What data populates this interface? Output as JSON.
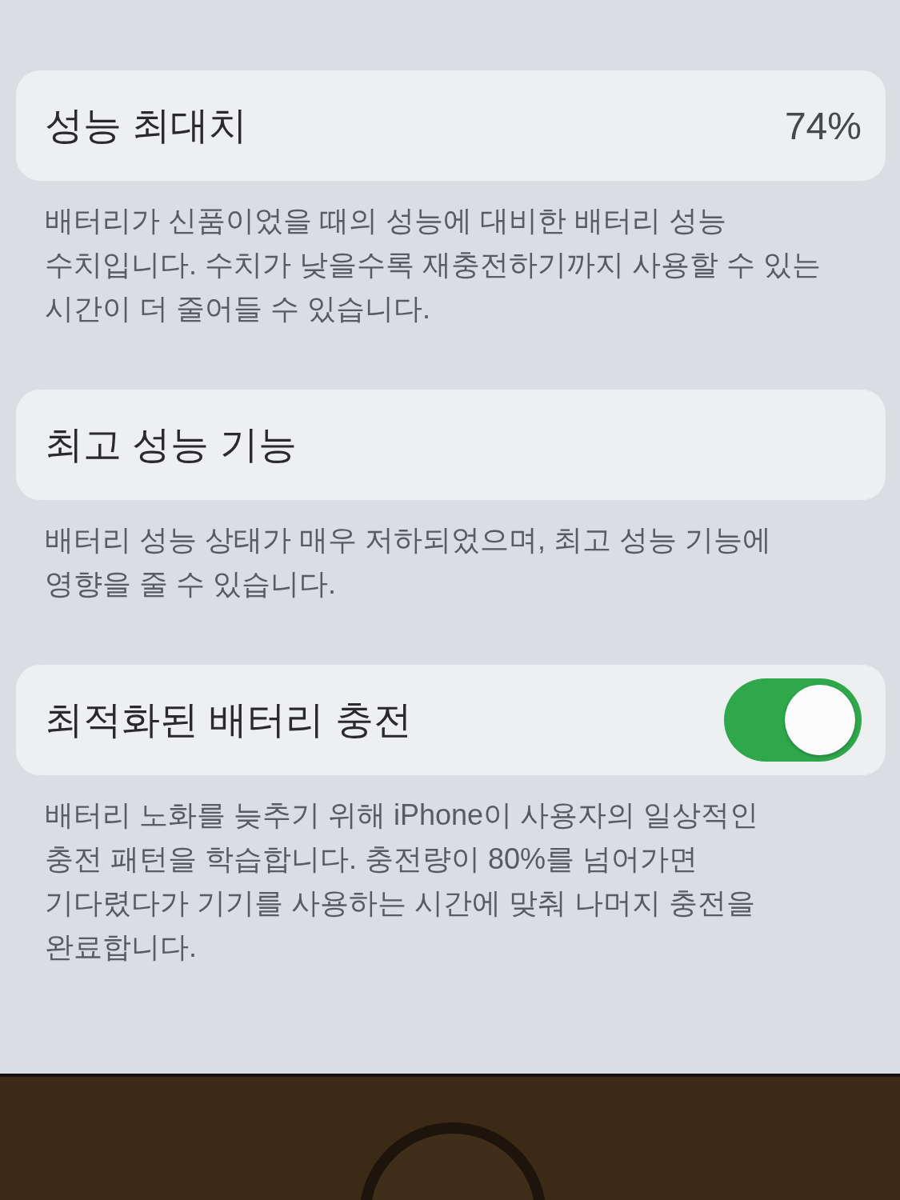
{
  "sections": [
    {
      "kind": "value",
      "title": "성능 최대치",
      "value": "74%",
      "footer": "배터리가 신품이었을 때의 성능에 대비한 배터리 성능 수치입니다. 수치가 낮을수록 재충전하기까지 사용할 수 있는 시간이 더 줄어들 수 있습니다."
    },
    {
      "kind": "plain",
      "title": "최고 성능 기능",
      "footer": "배터리 성능 상태가 매우 저하되었으며, 최고 성능 기능에 영향을 줄 수 있습니다."
    },
    {
      "kind": "toggle",
      "title": "최적화된 배터리 충전",
      "toggle": {
        "on": true
      },
      "footer": "배터리 노화를 늦추기 위해 iPhone이 사용자의 일상적인 충전 패턴을 학습합니다. 충전량이 80%를 넘어가면 기다렸다가 기기를 사용하는 시간에 맞춰 나머지 충전을 완료합니다."
    }
  ]
}
